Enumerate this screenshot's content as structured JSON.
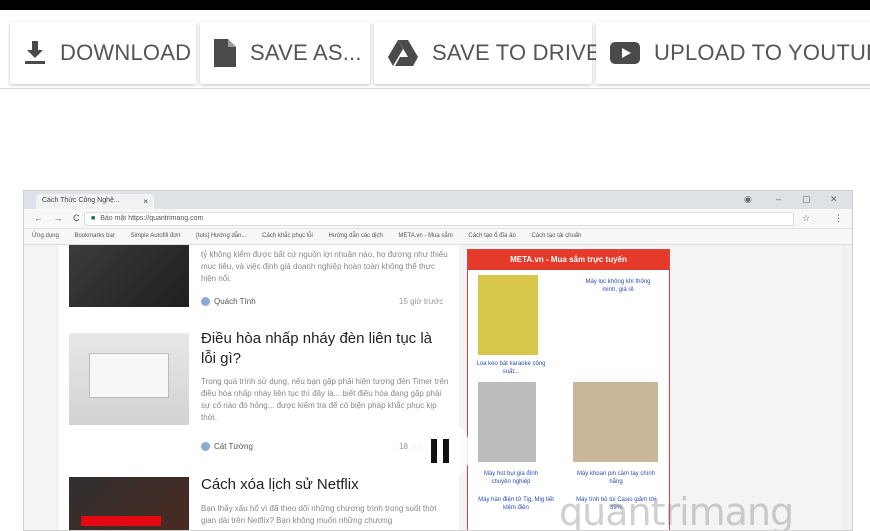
{
  "toolbar": {
    "buttons": [
      {
        "label": "DOWNLOAD",
        "icon": "download-icon"
      },
      {
        "label": "SAVE AS...",
        "icon": "file-icon"
      },
      {
        "label": "SAVE TO DRIVE",
        "icon": "google-drive-icon"
      },
      {
        "label": "UPLOAD TO YOUTUBE",
        "icon": "youtube-icon"
      }
    ]
  },
  "browser": {
    "tab_title": "Cách Thức Công Nghệ...",
    "tab_close": "×",
    "nav_glyphs": "← → C",
    "secure_label": "Bảo mật",
    "url": "https://quantrimang.com",
    "bookmarks": [
      "Ứng dụng",
      "Bookmarks bar",
      "Simple Autofill đơn",
      "[tuts] Hướng dẫn...",
      "Cách khắc phục lỗi",
      "Hướng dẫn các dịch",
      "META.vn - Mua sắm",
      "Cách tạo ổ đĩa ảo",
      "Cách tạo tài chuẩn"
    ]
  },
  "articles": [
    {
      "snippet": "tỷ không kiểm được bất cứ nguồn lợi nhuận nào, họ đương như thiếu mục tiêu, và việc định giá doanh nghiệp hoàn toàn không thể thực hiện nổi.",
      "author": "Quách Tính",
      "time": "15 giờ trước"
    },
    {
      "title": "Điều hòa nhấp nháy đèn liên tục là lỗi gì?",
      "snippet": "Trong quá trình sử dụng, nếu bạn gặp phải hiện tượng đèn Timer trên điều hòa nhấp nháy liên tục thì đây là... biết điều hòa đang gặp phải sự cố nào đó hỏng... được kiểm tra để có biện pháp khắc phục kịp thời.",
      "author": "Cát Tường",
      "time": "18 giờ..."
    },
    {
      "title": "Cách xóa lịch sử Netflix",
      "snippet": "Bạn thấy xấu hổ vì đã theo dõi những chương trình trong suốt thời gian dài trên Netflix? Bạn không muốn những chương"
    }
  ],
  "ad": {
    "header": "META.vn - Mua sắm trực tuyến",
    "items": [
      "Máy lọc không khí thông minh, giá rẻ",
      "Loa kéo bát karaoke công suất...",
      "Máy hút bụi gia đình chuyên nghiệp",
      "Máy khoan pin cầm tay chính hãng",
      "Máy hàn điện tử Tig, Mig tiết kiệm điện",
      "Máy tính bỏ túi Casio giảm tới 39%"
    ]
  },
  "player": {
    "state": "paused"
  },
  "watermark": "quantrimang"
}
